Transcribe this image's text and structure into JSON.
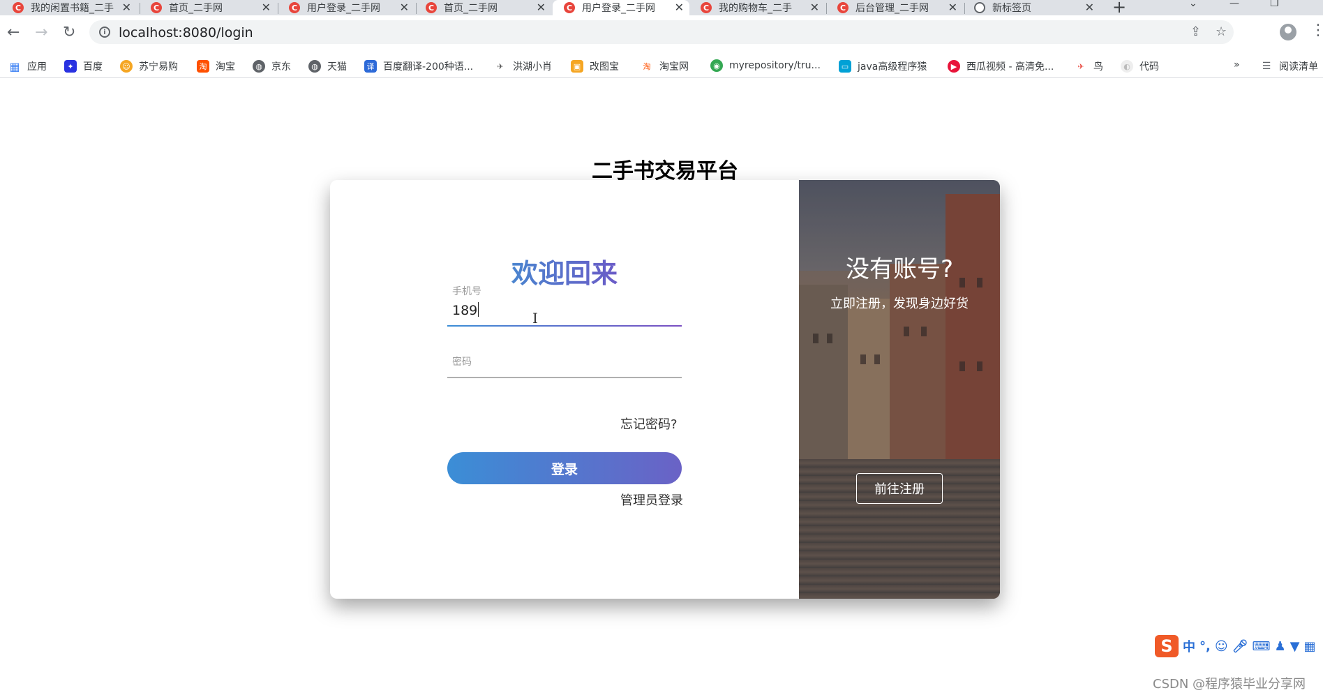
{
  "browser": {
    "tabs": [
      {
        "title": "我的闲置书籍_二手",
        "icon": "site-c-icon"
      },
      {
        "title": "首页_二手网",
        "icon": "site-c-icon"
      },
      {
        "title": "用户登录_二手网",
        "icon": "site-c-icon"
      },
      {
        "title": "首页_二手网",
        "icon": "site-c-icon"
      },
      {
        "title": "用户登录_二手网",
        "icon": "site-c-icon",
        "active": true
      },
      {
        "title": "我的购物车_二手",
        "icon": "site-c-icon"
      },
      {
        "title": "后台管理_二手网",
        "icon": "site-c-icon"
      },
      {
        "title": "新标签页",
        "icon": "chrome-icon"
      }
    ],
    "url": "localhost:8080/login",
    "bookmarks": [
      {
        "label": "应用",
        "icon": "apps-grid-icon",
        "color": "#4285f4"
      },
      {
        "label": "百度",
        "icon": "baidu-paw-icon",
        "color": "#2932e1"
      },
      {
        "label": "苏宁易购",
        "icon": "suning-icon",
        "color": "#f5a623"
      },
      {
        "label": "淘宝",
        "icon": "taobao-icon",
        "color": "#ff5000"
      },
      {
        "label": "京东",
        "icon": "globe-icon",
        "color": "#5f6368"
      },
      {
        "label": "天猫",
        "icon": "globe-icon",
        "color": "#5f6368"
      },
      {
        "label": "百度翻译-200种语...",
        "icon": "translate-icon",
        "color": "#2d6ad8"
      },
      {
        "label": "洪湖小肖",
        "icon": "bird-icon",
        "color": "#555555"
      },
      {
        "label": "改图宝",
        "icon": "gaitubao-icon",
        "color": "#f5a623"
      },
      {
        "label": "淘宝网",
        "icon": "taobao-icon",
        "color": "#ff5000"
      },
      {
        "label": "myrepository/tru...",
        "icon": "chrome-icon",
        "color": "#34a853"
      },
      {
        "label": "java高级程序猿",
        "icon": "bilibili-icon",
        "color": "#00a1d6"
      },
      {
        "label": "西瓜视频 - 高清免...",
        "icon": "xigua-icon",
        "color": "#e8143a"
      },
      {
        "label": "鸟",
        "icon": "bird-icon",
        "color": "#e8453c"
      },
      {
        "label": "代码",
        "icon": "code-icon",
        "color": "#cccccc"
      }
    ],
    "reading_list": "阅读清单"
  },
  "page": {
    "platform_title": "二手书交易平台",
    "welcome": "欢迎回来",
    "phone": {
      "label": "手机号",
      "value": "189"
    },
    "password": {
      "label": "密码",
      "value": ""
    },
    "forgot": "忘记密码?",
    "login_button": "登录",
    "admin_login": "管理员登录",
    "register_panel": {
      "title": "没有账号?",
      "subtitle": "立即注册，发现身边好货",
      "button": "前往注册"
    }
  },
  "overlay": {
    "ime_mode": "中",
    "watermark": "CSDN @程序猿毕业分享网"
  },
  "colors": {
    "accent_start": "#3b8ed6",
    "accent_end": "#6a62c6",
    "favicon_red": "#e8453c"
  }
}
